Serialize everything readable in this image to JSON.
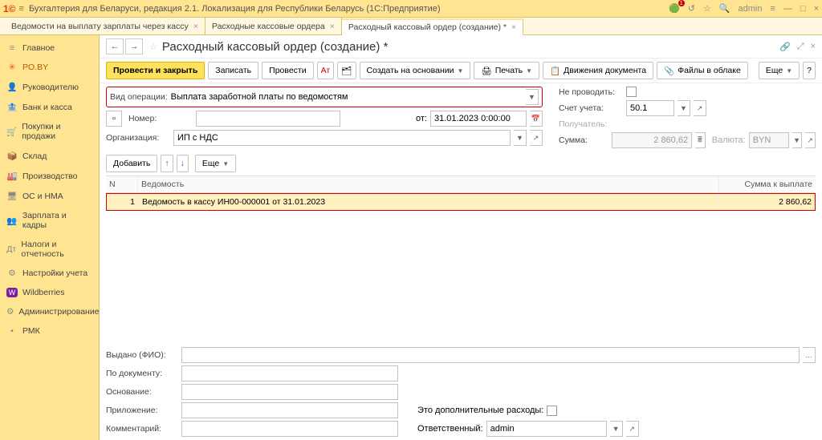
{
  "app": {
    "title": "Бухгалтерия для Беларуси, редакция 2.1. Локализация для Республики Беларусь  (1С:Предприятие)",
    "user": "admin",
    "notif_count": "1"
  },
  "tabs": [
    {
      "label": "Ведомости на выплату зарплаты через кассу"
    },
    {
      "label": "Расходные кассовые ордера"
    },
    {
      "label": "Расходный кассовый ордер (создание) *",
      "active": true
    }
  ],
  "sidebar": [
    {
      "icon": "≡",
      "label": "Главное"
    },
    {
      "icon": "✳",
      "label": "PO.BY",
      "selected": true
    },
    {
      "icon": "👤",
      "label": "Руководителю"
    },
    {
      "icon": "🏦",
      "label": "Банк и касса"
    },
    {
      "icon": "🛒",
      "label": "Покупки и продажи"
    },
    {
      "icon": "📦",
      "label": "Склад"
    },
    {
      "icon": "🏭",
      "label": "Производство"
    },
    {
      "icon": "🖥",
      "label": "ОС и НМА"
    },
    {
      "icon": "👥",
      "label": "Зарплата и кадры"
    },
    {
      "icon": "Дт",
      "label": "Налоги и отчетность"
    },
    {
      "icon": "⚙",
      "label": "Настройки учета"
    },
    {
      "icon": "W",
      "label": "Wildberries"
    },
    {
      "icon": "⚙",
      "label": "Администрирование"
    },
    {
      "icon": "•",
      "label": "РМК"
    }
  ],
  "doc": {
    "title": "Расходный кассовый ордер (создание) *"
  },
  "toolbar": {
    "submit": "Провести и закрыть",
    "save": "Записать",
    "post": "Провести",
    "create": "Создать на основании",
    "print": "Печать",
    "moves": "Движения документа",
    "files": "Файлы в облаке",
    "more": "Еще"
  },
  "form": {
    "op_label": "Вид операции:",
    "op_value": "Выплата заработной платы по ведомостям",
    "number_label": "Номер:",
    "number_value": "",
    "from_label": "от:",
    "from_value": "31.01.2023  0:00:00",
    "org_label": "Организация:",
    "org_value": "ИП с НДС",
    "nopost_label": "Не проводить:",
    "acct_label": "Счет учета:",
    "acct_value": "50.1",
    "recv_label": "Получатель:",
    "sum_label": "Сумма:",
    "sum_value": "2 860,62",
    "cur_label": "Валюта:",
    "cur_value": "BYN",
    "add": "Добавить"
  },
  "grid": {
    "col_n": "N",
    "col_v": "Ведомость",
    "col_s": "Сумма к выплате",
    "row": {
      "n": "1",
      "v": "Ведомость в кассу ИН00-000001 от 31.01.2023",
      "s": "2 860,62"
    }
  },
  "bottom": {
    "fio": "Выдано (ФИО):",
    "bydoc": "По документу:",
    "basis": "Основание:",
    "attach": "Приложение:",
    "extra": "Это дополнительные расходы:",
    "comment": "Комментарий:",
    "resp": "Ответственный:",
    "resp_value": "admin"
  }
}
